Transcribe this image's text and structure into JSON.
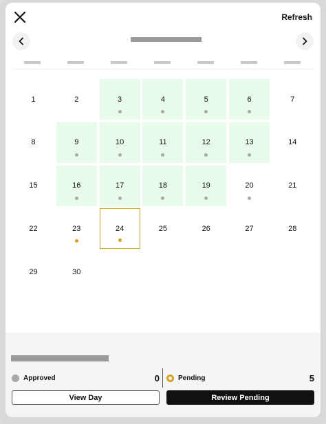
{
  "header": {
    "refresh_label": "Refresh"
  },
  "calendar": {
    "days": [
      {
        "day": "1",
        "status": "none",
        "dot": "none"
      },
      {
        "day": "2",
        "status": "none",
        "dot": "none"
      },
      {
        "day": "3",
        "status": "approved",
        "dot": "gray"
      },
      {
        "day": "4",
        "status": "approved",
        "dot": "gray"
      },
      {
        "day": "5",
        "status": "approved",
        "dot": "gray"
      },
      {
        "day": "6",
        "status": "approved",
        "dot": "gray"
      },
      {
        "day": "7",
        "status": "none",
        "dot": "none"
      },
      {
        "day": "8",
        "status": "none",
        "dot": "none"
      },
      {
        "day": "9",
        "status": "approved",
        "dot": "gray"
      },
      {
        "day": "10",
        "status": "approved",
        "dot": "gray"
      },
      {
        "day": "11",
        "status": "approved",
        "dot": "gray"
      },
      {
        "day": "12",
        "status": "approved",
        "dot": "gray"
      },
      {
        "day": "13",
        "status": "approved",
        "dot": "gray"
      },
      {
        "day": "14",
        "status": "none",
        "dot": "none"
      },
      {
        "day": "15",
        "status": "none",
        "dot": "none"
      },
      {
        "day": "16",
        "status": "approved",
        "dot": "gray"
      },
      {
        "day": "17",
        "status": "approved",
        "dot": "gray"
      },
      {
        "day": "18",
        "status": "approved",
        "dot": "gray"
      },
      {
        "day": "19",
        "status": "approved",
        "dot": "gray"
      },
      {
        "day": "20",
        "status": "none",
        "dot": "gray"
      },
      {
        "day": "21",
        "status": "none",
        "dot": "none"
      },
      {
        "day": "22",
        "status": "none",
        "dot": "none"
      },
      {
        "day": "23",
        "status": "none",
        "dot": "gold"
      },
      {
        "day": "24",
        "status": "selected",
        "dot": "gold"
      },
      {
        "day": "25",
        "status": "none",
        "dot": "none"
      },
      {
        "day": "26",
        "status": "none",
        "dot": "none"
      },
      {
        "day": "27",
        "status": "none",
        "dot": "none"
      },
      {
        "day": "28",
        "status": "none",
        "dot": "none"
      },
      {
        "day": "29",
        "status": "none",
        "dot": "none"
      },
      {
        "day": "30",
        "status": "none",
        "dot": "none"
      }
    ]
  },
  "summary": {
    "approved_label": "Approved",
    "approved_count": "0",
    "pending_label": "Pending",
    "pending_count": "5"
  },
  "actions": {
    "view_day_label": "View Day",
    "review_pending_label": "Review Pending"
  },
  "colors": {
    "approved_bg": "#e8fbea",
    "pending_accent": "#d6a21f",
    "primary_button": "#111111"
  },
  "icons": {
    "close": "close-icon",
    "prev": "chevron-left-icon",
    "next": "chevron-right-icon"
  }
}
